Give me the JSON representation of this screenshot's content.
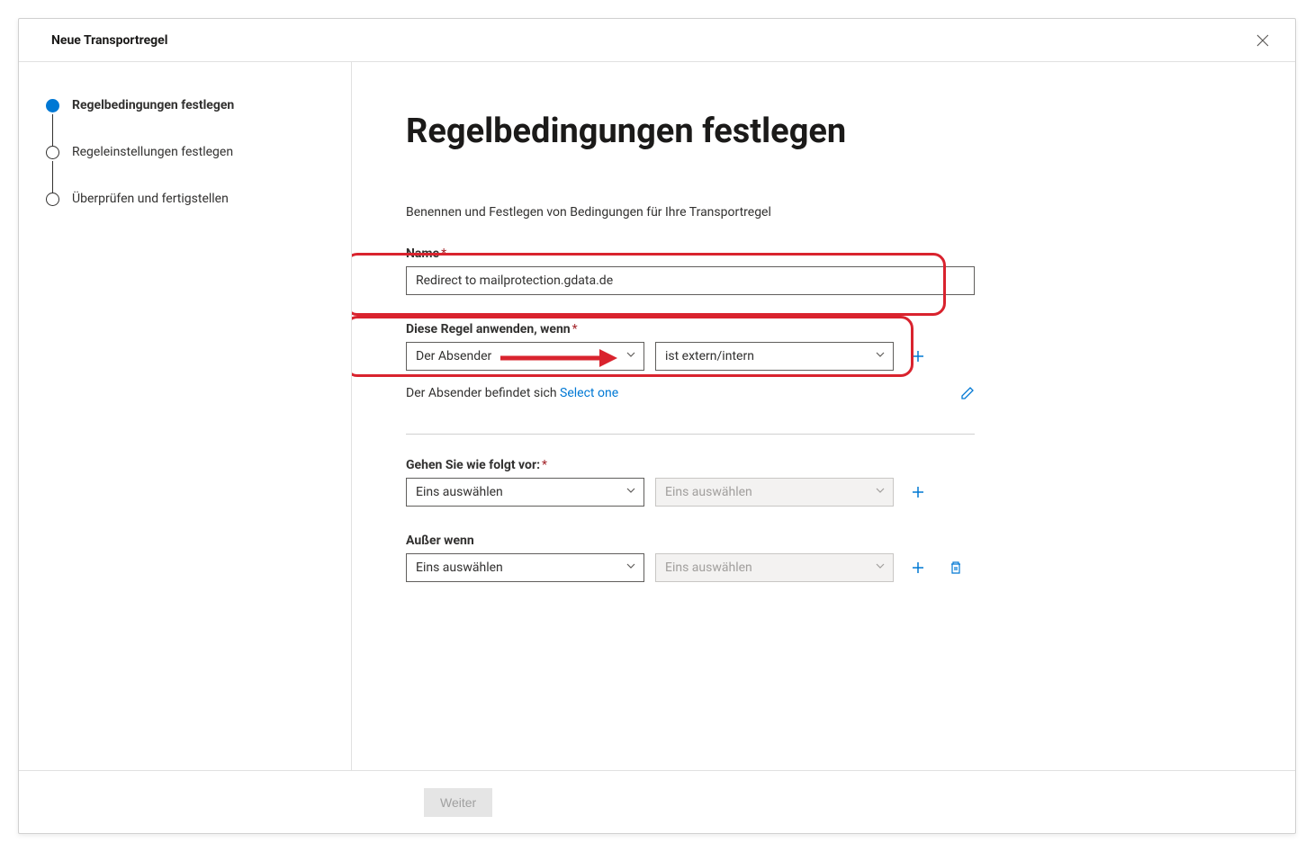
{
  "header": {
    "title": "Neue Transportregel"
  },
  "steps": [
    {
      "label": "Regelbedingungen festlegen",
      "active": true
    },
    {
      "label": "Regeleinstellungen festlegen",
      "active": false
    },
    {
      "label": "Überprüfen und fertigstellen",
      "active": false
    }
  ],
  "page": {
    "title": "Regelbedingungen festlegen",
    "subtitle": "Benennen und Festlegen von Bedingungen für Ihre Transportregel"
  },
  "form": {
    "name_label": "Name",
    "name_value": "Redirect to mailprotection.gdata.de",
    "apply_label": "Diese Regel anwenden, wenn",
    "apply_dropdown1": "Der Absender",
    "apply_dropdown2": "ist extern/intern",
    "apply_helper_prefix": "Der Absender befindet sich ",
    "apply_helper_link": "Select one",
    "action_label": "Gehen Sie wie folgt vor:",
    "action_dropdown1": "Eins auswählen",
    "action_dropdown2_placeholder": "Eins auswählen",
    "except_label": "Außer wenn",
    "except_dropdown1": "Eins auswählen",
    "except_dropdown2_placeholder": "Eins auswählen"
  },
  "footer": {
    "next": "Weiter"
  }
}
